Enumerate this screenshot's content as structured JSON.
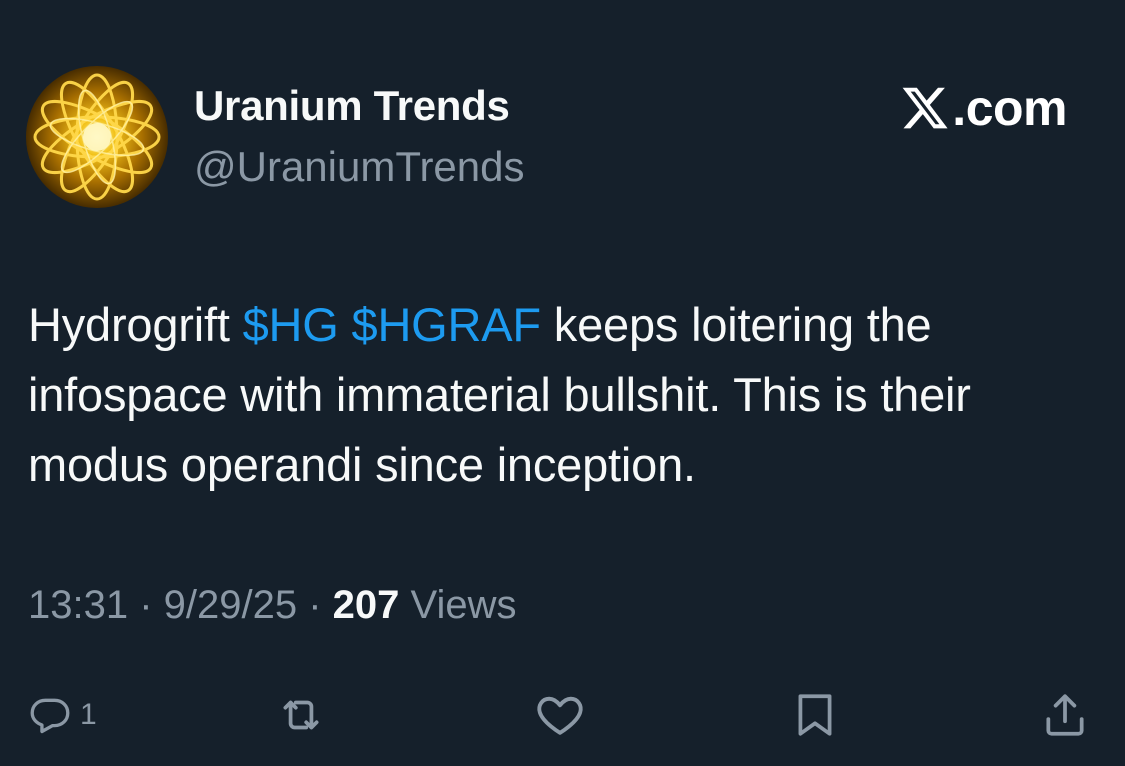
{
  "account": {
    "display_name": "Uranium Trends",
    "handle": "@UraniumTrends",
    "avatar_icon": "golden-atom-icon"
  },
  "brand": {
    "logo_icon": "x-logo-icon",
    "text": ".com"
  },
  "tweet": {
    "text_before": "Hydrogrift ",
    "cashtag_1": "$HG",
    "space": " ",
    "cashtag_2": "$HGRAF",
    "text_after": " keeps loitering the infospace with immaterial bullshit. This is their modus operandi since inception."
  },
  "meta": {
    "time": "13:31",
    "separator_1": " · ",
    "date": "9/29/25",
    "separator_2": " · ",
    "views_count": "207",
    "views_label": " Views"
  },
  "actions": {
    "reply_icon": "reply-icon",
    "reply_count": "1",
    "retweet_icon": "retweet-icon",
    "like_icon": "heart-icon",
    "bookmark_icon": "bookmark-icon",
    "share_icon": "share-icon"
  },
  "colors": {
    "background": "#15202b",
    "primary_text": "#f7f9f9",
    "secondary_text": "#8b98a5",
    "link": "#1d9bf0"
  }
}
